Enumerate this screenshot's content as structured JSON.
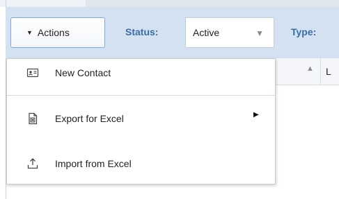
{
  "toolbar": {
    "actions_label": "Actions",
    "status_label": "Status:",
    "status_value": "Active",
    "type_label": "Type:"
  },
  "grid": {
    "column_partial": "L"
  },
  "menu": {
    "items": [
      {
        "label": "New Contact",
        "icon": "contact-card-icon",
        "has_submenu": false
      },
      {
        "label": "Export for Excel",
        "icon": "excel-file-icon",
        "has_submenu": true
      },
      {
        "label": "Import from Excel",
        "icon": "upload-icon",
        "has_submenu": false
      }
    ]
  },
  "colors": {
    "toolbar_bg": "#d3e1f0",
    "label_blue": "#3a6ea5",
    "button_border": "#7fa9d8"
  }
}
